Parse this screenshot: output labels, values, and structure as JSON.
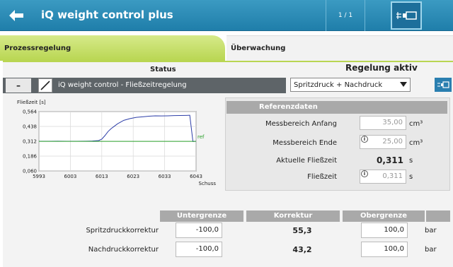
{
  "header": {
    "title": "iQ weight control plus",
    "pager": "1 / 1",
    "icons": {
      "back": "back-arrow-icon",
      "tool": "injection-unit-icon"
    }
  },
  "tabs": [
    {
      "label": "Prozessregelung",
      "active": true
    },
    {
      "label": "Überwachung",
      "active": false
    }
  ],
  "section": {
    "status_label": "Status",
    "regelung_label": "Regelung aktiv",
    "collapse_label": "–",
    "enabled": true,
    "function_label": "iQ weight control - Fließzeitregelung",
    "mode_selected": "Spritzdruck + Nachdruck"
  },
  "chart_data": {
    "type": "line",
    "title": "Fließzeit [s]",
    "xlabel": "Schuss",
    "ylabel": "Fließzeit [s]",
    "xlim": [
      5993,
      6043
    ],
    "ylim": [
      0.06,
      0.564
    ],
    "xticks": [
      5993,
      6003,
      6013,
      6023,
      6033,
      6043
    ],
    "yticks": [
      0.564,
      0.438,
      0.312,
      0.186,
      0.06
    ],
    "ytick_labels": [
      "0,564",
      "0,438",
      "0,312",
      "0,186",
      "0,060"
    ],
    "grid": true,
    "series": [
      {
        "name": "",
        "color": "#2e3fa8",
        "x": [
          5993,
          5996,
          5999,
          6002,
          6005,
          6008,
          6010,
          6012,
          6013,
          6014,
          6015,
          6016,
          6017,
          6018,
          6019,
          6020,
          6022,
          6024,
          6026,
          6028,
          6030,
          6032,
          6034,
          6036,
          6038,
          6040,
          6041,
          6042,
          6043
        ],
        "y": [
          0.312,
          0.312,
          0.313,
          0.312,
          0.312,
          0.313,
          0.314,
          0.318,
          0.33,
          0.36,
          0.395,
          0.42,
          0.44,
          0.46,
          0.475,
          0.49,
          0.505,
          0.515,
          0.52,
          0.525,
          0.528,
          0.527,
          0.528,
          0.53,
          0.531,
          0.532,
          0.533,
          0.31,
          0.312
        ]
      },
      {
        "name": "ref",
        "color": "#2aa02a",
        "x": [
          5993,
          6043
        ],
        "y": [
          0.311,
          0.311
        ]
      }
    ],
    "ref_label": "ref"
  },
  "referenz": {
    "header": "Referenzdaten",
    "rows": [
      {
        "label": "Messbereich Anfang",
        "value": "35,00",
        "unit": "cm³",
        "has_info": true
      },
      {
        "label": "Messbereich Ende",
        "value": "25,00",
        "unit": "cm³",
        "has_info": true
      },
      {
        "label": "Aktuelle Fließzeit",
        "value": "0,311",
        "unit": "s",
        "has_info": false
      },
      {
        "label": "Fließzeit",
        "value": "0,311",
        "unit": "s",
        "has_info": true
      }
    ]
  },
  "korrektur": {
    "headers": [
      "Untergrenze",
      "Korrektur",
      "Obergrenze"
    ],
    "rows": [
      {
        "label": "Spritzdruckkorrektur",
        "lower": "-100,0",
        "value": "55,3",
        "upper": "100,0",
        "unit": "bar"
      },
      {
        "label": "Nachdruckkorrektur",
        "lower": "-100,0",
        "value": "43,2",
        "upper": "100,0",
        "unit": "bar"
      }
    ]
  },
  "colors": {
    "header_blue": "#2a88b4",
    "tab_green": "#c5df6e",
    "series_blue": "#2e3fa8",
    "ref_green": "#2aa02a"
  }
}
